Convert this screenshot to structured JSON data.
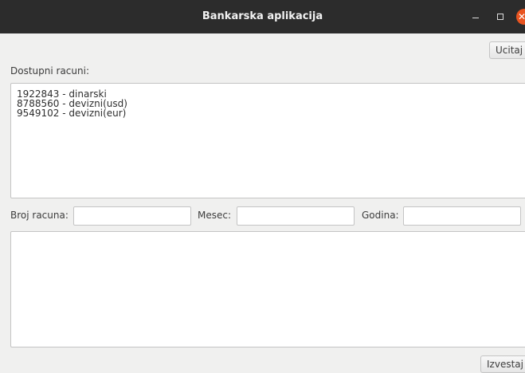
{
  "window": {
    "title": "Bankarska aplikacija",
    "minimize_icon": "minimize-icon",
    "maximize_icon": "maximize-icon",
    "close_icon": "close-icon",
    "close_glyph": "✕"
  },
  "toolbar": {
    "load_label": "Ucitaj"
  },
  "accounts": {
    "label": "Dostupni racuni:",
    "lines": [
      "1922843 - dinarski",
      "8788560 - devizni(usd)",
      "9549102 - devizni(eur)"
    ]
  },
  "form": {
    "account_label": "Broj racuna:",
    "account_value": "",
    "month_label": "Mesec:",
    "month_value": "",
    "year_label": "Godina:",
    "year_value": ""
  },
  "report": {
    "text": "",
    "button_label": "Izvestaj"
  },
  "colors": {
    "titlebar": "#2c2c2c",
    "close": "#e95420",
    "background": "#f0f0ef"
  }
}
